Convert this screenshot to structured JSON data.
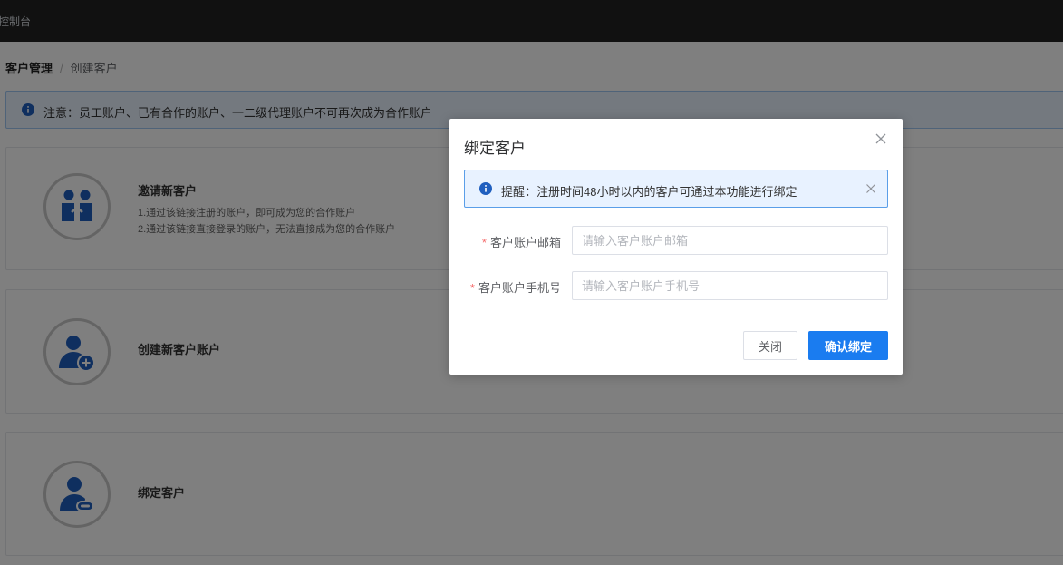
{
  "topbar": {
    "title": "控制台"
  },
  "breadcrumb": {
    "parent": "客户管理",
    "separator": "/",
    "current": "创建客户"
  },
  "notice": {
    "text": "注意：员工账户、已有合作的账户、一二级代理账户不可再次成为合作账户"
  },
  "cards": [
    {
      "title": "邀请新客户",
      "desc_line1": "1.通过该链接注册的账户，即可成为您的合作账户",
      "desc_line2": "2.通过该链接直接登录的账户，无法直接成为您的合作账户",
      "icon": "handshake-icon"
    },
    {
      "title": "创建新客户账户",
      "icon": "user-add-icon"
    },
    {
      "title": "绑定客户",
      "icon": "user-link-icon"
    }
  ],
  "dialog": {
    "title": "绑定客户",
    "alert_text": "提醒：注册时间48小时以内的客户可通过本功能进行绑定",
    "fields": [
      {
        "required_mark": "*",
        "label": "客户账户邮箱",
        "placeholder": "请输入客户账户邮箱",
        "value": ""
      },
      {
        "required_mark": "*",
        "label": "客户账户手机号",
        "placeholder": "请输入客户账户手机号",
        "value": ""
      }
    ],
    "buttons": {
      "close": "关闭",
      "confirm": "确认绑定"
    }
  },
  "colors": {
    "primary": "#1a7cf0",
    "icon_blue": "#1f5fbf",
    "topbar": "#232323",
    "required": "#f56c6c"
  }
}
